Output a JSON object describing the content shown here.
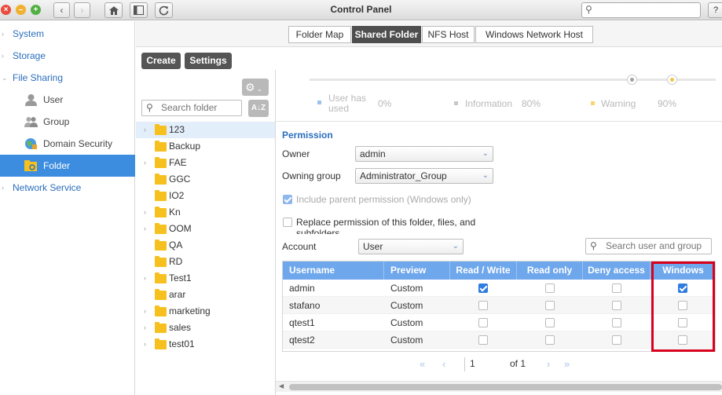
{
  "window": {
    "title": "Control Panel",
    "search_value": "",
    "help_label": "?"
  },
  "nav": {
    "items": [
      {
        "label": "System",
        "level": 1
      },
      {
        "label": "Storage",
        "level": 1
      },
      {
        "label": "File Sharing",
        "level": 1
      },
      {
        "label": "User",
        "level": 2
      },
      {
        "label": "Group",
        "level": 2
      },
      {
        "label": "Domain Security",
        "level": 2
      },
      {
        "label": "Folder",
        "level": 2,
        "active": true
      },
      {
        "label": "Network Service",
        "level": 1
      }
    ]
  },
  "tabs": [
    {
      "label": "Folder Map"
    },
    {
      "label": "Shared Folder",
      "active": true
    },
    {
      "label": "NFS Host"
    },
    {
      "label": "Windows Network Host"
    }
  ],
  "toolbar": {
    "create_label": "Create",
    "settings_label": "Settings",
    "sort_label": "A↓Z"
  },
  "folder_search": {
    "placeholder": "Search folder"
  },
  "folders": [
    {
      "name": "123",
      "expandable": true,
      "selected": true
    },
    {
      "name": "Backup",
      "expandable": false
    },
    {
      "name": "FAE",
      "expandable": true
    },
    {
      "name": "GGC",
      "expandable": false
    },
    {
      "name": "IO2",
      "expandable": false
    },
    {
      "name": "Kn",
      "expandable": true
    },
    {
      "name": "OOM",
      "expandable": true
    },
    {
      "name": "QA",
      "expandable": false
    },
    {
      "name": "RD",
      "expandable": false
    },
    {
      "name": "Test1",
      "expandable": true
    },
    {
      "name": "arar",
      "expandable": false
    },
    {
      "name": "marketing",
      "expandable": true
    },
    {
      "name": "sales",
      "expandable": true
    },
    {
      "name": "test01",
      "expandable": true
    }
  ],
  "quota": {
    "legend": [
      {
        "label": "User has used",
        "value": "0%",
        "color": "#9ec2ef"
      },
      {
        "label": "Information",
        "value": "80%",
        "color": "#c8c8c8"
      },
      {
        "label": "Warning",
        "value": "90%",
        "color": "#f7d46e"
      }
    ],
    "knob_colors": [
      "#a0a0a0",
      "#f2c445"
    ]
  },
  "permission": {
    "title": "Permission",
    "owner_label": "Owner",
    "owner_value": "admin",
    "owning_group_label": "Owning group",
    "owning_group_value": "Administrator_Group",
    "include_parent_label": "Include parent permission (Windows only)",
    "include_parent_checked": true,
    "replace_label": "Replace permission of this folder, files, and subfolders",
    "replace_checked": false,
    "account_label": "Account",
    "account_value": "User",
    "user_search_placeholder": "Search user and group"
  },
  "table": {
    "columns": [
      "Username",
      "Preview",
      "Read / Write",
      "Read only",
      "Deny access",
      "Windows"
    ],
    "rows": [
      {
        "username": "admin",
        "preview": "Custom",
        "rw": true,
        "ro": false,
        "deny": false,
        "windows": true
      },
      {
        "username": "stafano",
        "preview": "Custom",
        "rw": false,
        "ro": false,
        "deny": false,
        "windows": false
      },
      {
        "username": "qtest1",
        "preview": "Custom",
        "rw": false,
        "ro": false,
        "deny": false,
        "windows": false
      },
      {
        "username": "qtest2",
        "preview": "Custom",
        "rw": false,
        "ro": false,
        "deny": false,
        "windows": false
      }
    ]
  },
  "pager": {
    "current_page": "1",
    "of_label": "of 1"
  },
  "colors": {
    "accent": "#3c8de0",
    "nav_text": "#2a6ebd",
    "table_header": "#6fa7ec",
    "highlight": "#d8001c"
  }
}
